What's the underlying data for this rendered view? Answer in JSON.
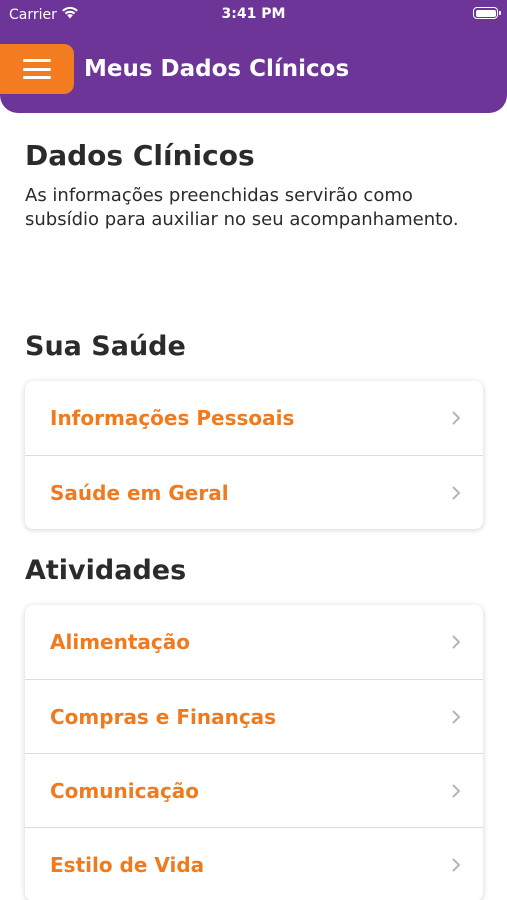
{
  "status_bar": {
    "carrier": "Carrier",
    "time": "3:41 PM",
    "wifi_icon": "wifi-icon",
    "battery_icon": "battery-icon"
  },
  "header": {
    "menu_icon": "hamburger-icon",
    "title": "Meus Dados Clínicos"
  },
  "intro": {
    "title": "Dados Clínicos",
    "description": "As informações preenchidas servirão como subsídio para auxiliar no seu acompanhamento."
  },
  "sections": [
    {
      "title": "Sua Saúde",
      "items": [
        {
          "label": "Informações Pessoais"
        },
        {
          "label": "Saúde em Geral"
        }
      ]
    },
    {
      "title": "Atividades",
      "items": [
        {
          "label": "Alimentação"
        },
        {
          "label": "Compras e Finanças"
        },
        {
          "label": "Comunicação"
        },
        {
          "label": "Estilo de Vida"
        }
      ]
    }
  ],
  "colors": {
    "brand_purple": "#6d3597",
    "accent_orange": "#f47c20",
    "item_label_orange": "#f07a1e",
    "text_dark": "#2b2b2b"
  }
}
